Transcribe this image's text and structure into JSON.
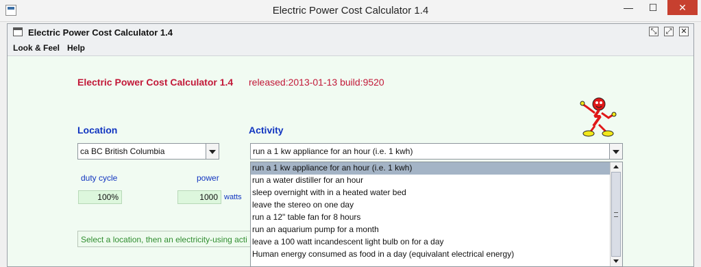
{
  "window": {
    "title": "Electric Power Cost Calculator 1.4",
    "minimize": "—",
    "maximize": "☐",
    "close": "✕"
  },
  "frame": {
    "title": "Electric Power Cost Calculator 1.4",
    "iconify": "⤡",
    "maximize": "⤢",
    "close": "✕"
  },
  "menu": {
    "look_feel": "Look & Feel",
    "help": "Help"
  },
  "header": {
    "app_title": "Electric Power Cost Calculator 1.4",
    "release": "released:2013-01-13 build:9520"
  },
  "location": {
    "label": "Location",
    "selected": "ca BC British Columbia"
  },
  "activity": {
    "label": "Activity",
    "selected": "run a 1 kw appliance for an hour (i.e. 1 kwh)",
    "options": [
      "run a 1 kw appliance for an hour (i.e. 1 kwh)",
      "run a water distiller for an hour",
      "sleep overnight with in a heated water bed",
      "leave the stereo on one day",
      "run a 12\" table fan for 8 hours",
      "run an aquarium pump for a month",
      "leave a 100 watt incandescent light bulb on for a day",
      "Human energy consumed as food in a day (equivalant electrical energy)"
    ]
  },
  "duty_cycle": {
    "label": "duty cycle",
    "value": "100%"
  },
  "power": {
    "label": "power",
    "value": "1000",
    "unit": "watts"
  },
  "status": {
    "text": "Select a location, then an electricity-using acti"
  },
  "colors": {
    "title_red": "#c21838",
    "label_blue": "#1034c0",
    "status_green": "#2f8d2f",
    "content_bg": "#f1fbf2",
    "mascot_red": "#e01818",
    "mascot_yellow": "#f2e81a"
  }
}
